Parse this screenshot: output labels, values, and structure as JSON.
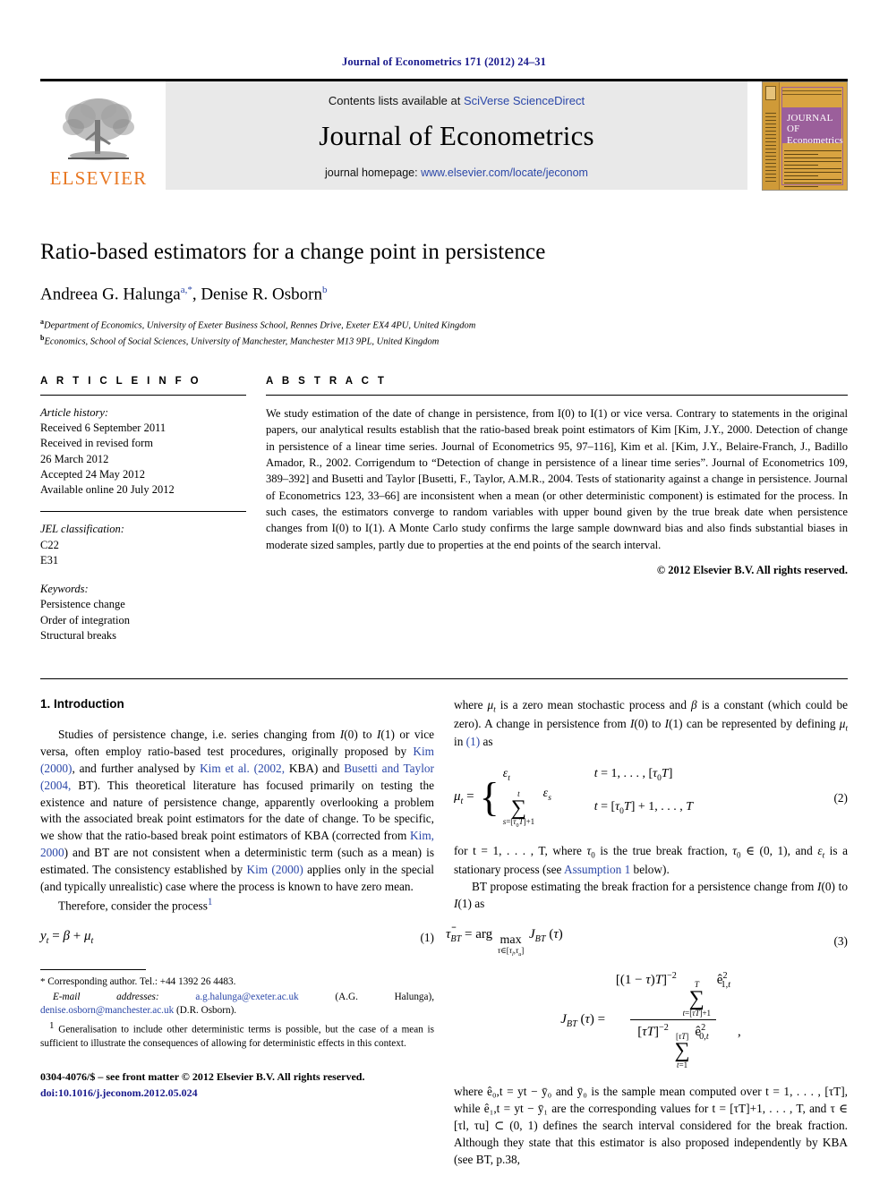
{
  "running_head": "Journal of Econometrics 171 (2012) 24–31",
  "masthead": {
    "publisher_logo_text": "ELSEVIER",
    "contents_prefix": "Contents lists available at ",
    "contents_link": "SciVerse ScienceDirect",
    "journal_title": "Journal of Econometrics",
    "homepage_prefix": "journal homepage: ",
    "homepage_url": "www.elsevier.com/locate/jeconom",
    "cover_title_line1": "JOURNAL OF",
    "cover_title_line2": "Econometrics"
  },
  "title": "Ratio-based estimators for a change point in persistence",
  "authors": {
    "text": "Andreea G. Halunga",
    "sup1": "a,*",
    "text2": ", Denise R. Osborn",
    "sup2": "b"
  },
  "affiliations": [
    {
      "mark": "a",
      "text": "Department of Economics, University of Exeter Business School, Rennes Drive, Exeter EX4 4PU, United Kingdom"
    },
    {
      "mark": "b",
      "text": "Economics, School of Social Sciences, University of Manchester, Manchester M13 9PL, United Kingdom"
    }
  ],
  "article_info": {
    "heading": "A R T I C L E   I N F O",
    "history_label": "Article history:",
    "history": [
      "Received 6 September 2011",
      "Received in revised form",
      "26 March 2012",
      "Accepted 24 May 2012",
      "Available online 20 July 2012"
    ],
    "jel_label": "JEL classification:",
    "jel": [
      "C22",
      "E31"
    ],
    "keywords_label": "Keywords:",
    "keywords": [
      "Persistence change",
      "Order of integration",
      "Structural breaks"
    ]
  },
  "abstract": {
    "heading": "A B S T R A C T",
    "text": "We study estimation of the date of change in persistence, from I(0) to I(1) or vice versa. Contrary to statements in the original papers, our analytical results establish that the ratio-based break point estimators of Kim [Kim, J.Y., 2000. Detection of change in persistence of a linear time series. Journal of Econometrics 95, 97–116], Kim et al. [Kim, J.Y., Belaire-Franch, J., Badillo Amador, R., 2002. Corrigendum to “Detection of change in persistence of a linear time series”. Journal of Econometrics 109, 389–392] and Busetti and Taylor [Busetti, F., Taylor, A.M.R., 2004. Tests of stationarity against a change in persistence. Journal of Econometrics 123, 33–66] are inconsistent when a mean (or other deterministic component) is estimated for the process. In such cases, the estimators converge to random variables with upper bound given by the true break date when persistence changes from I(0) to I(1). A Monte Carlo study confirms the large sample downward bias and also finds substantial biases in moderate sized samples, partly due to properties at the end points of the search interval.",
    "copyright": "© 2012 Elsevier B.V. All rights reserved."
  },
  "body": {
    "section1_title": "1. Introduction",
    "left_para1_a": "Studies of persistence change, i.e. series changing from ",
    "left_para1_b": " or vice versa, often employ ratio-based test procedures, originally proposed by ",
    "left_para1_link1": "Kim (2000)",
    "left_para1_c": ", and further analysed by ",
    "left_para1_link2": "Kim et al. (2002,",
    "left_para1_d": " KBA) and ",
    "left_para1_link3": "Busetti and Taylor (2004,",
    "left_para1_e": " BT). This theoretical literature has focused primarily on testing the existence and nature of persistence change, apparently overlooking a problem with the associated break point estimators for the date of change. To be specific, we show that the ratio-based break point estimators of KBA (corrected from ",
    "left_para1_link4": "Kim, 2000",
    "left_para1_f": ") and BT are not consistent when a deterministic term (such as a mean) is estimated. The consistency established by ",
    "left_para1_link5": "Kim (2000)",
    "left_para1_g": " applies only in the special (and typically unrealistic) case where the process is known to have zero mean.",
    "left_para2": "Therefore, consider the process",
    "left_para2_sup": "1",
    "eq1_num": "(1)",
    "right_para1_a": "where ",
    "right_para1_b": " is a zero mean stochastic process and ",
    "right_para1_c": " is a constant (which could be zero). A change in persistence from ",
    "right_para1_d": " can be represented by defining ",
    "right_para1_e": " in ",
    "right_para1_link": "(1)",
    "right_para1_f": " as",
    "eq2_num": "(2)",
    "right_para2_a": "for t = 1, . . . , T, where ",
    "right_para2_b": " is the true break fraction, ",
    "right_para2_c": " ∈ (0, 1), and ",
    "right_para2_d": " is a stationary process (see ",
    "right_para2_link": "Assumption 1",
    "right_para2_e": " below).",
    "right_para3_a": "BT propose estimating the break fraction for a persistence change from ",
    "right_para3_b": " as",
    "eq3_num": "(3)",
    "right_para4": "where ê₀,t = yt − ȳ₀ and ȳ₀ is the sample mean computed over t = 1, . . . , [τT], while ê₁,t = yt − ȳ₁ are the corresponding values for t = [τT]+1, . . . , T, and τ ∈ [τl, τu] ⊂ (0, 1) defines the search interval considered for the break fraction. Although they state that this estimator is also proposed independently by KBA (see BT, p.38,"
  },
  "footnotes": {
    "star_mark": "*",
    "star_text": "Corresponding author. Tel.: +44 1392 26 4483.",
    "email_label": "E-mail addresses:",
    "email1": "a.g.halunga@exeter.ac.uk",
    "email1_owner": " (A.G. Halunga),",
    "email2": "denise.osborn@manchester.ac.uk",
    "email2_owner": " (D.R. Osborn).",
    "fn1_mark": "1",
    "fn1_text": "Generalisation to include other deterministic terms is possible, but the case of a mean is sufficient to illustrate the consequences of allowing for deterministic effects in this context."
  },
  "imprint": {
    "issn_line": "0304-4076/$ – see front matter © 2012 Elsevier B.V. All rights reserved.",
    "doi_line": "doi:10.1016/j.jeconom.2012.05.024"
  },
  "colors": {
    "link_blue": "#2b47a8",
    "runhead_blue": "#1a1a8c",
    "elsevier_orange": "#E87722",
    "masthead_gray": "#e9e9e9"
  }
}
